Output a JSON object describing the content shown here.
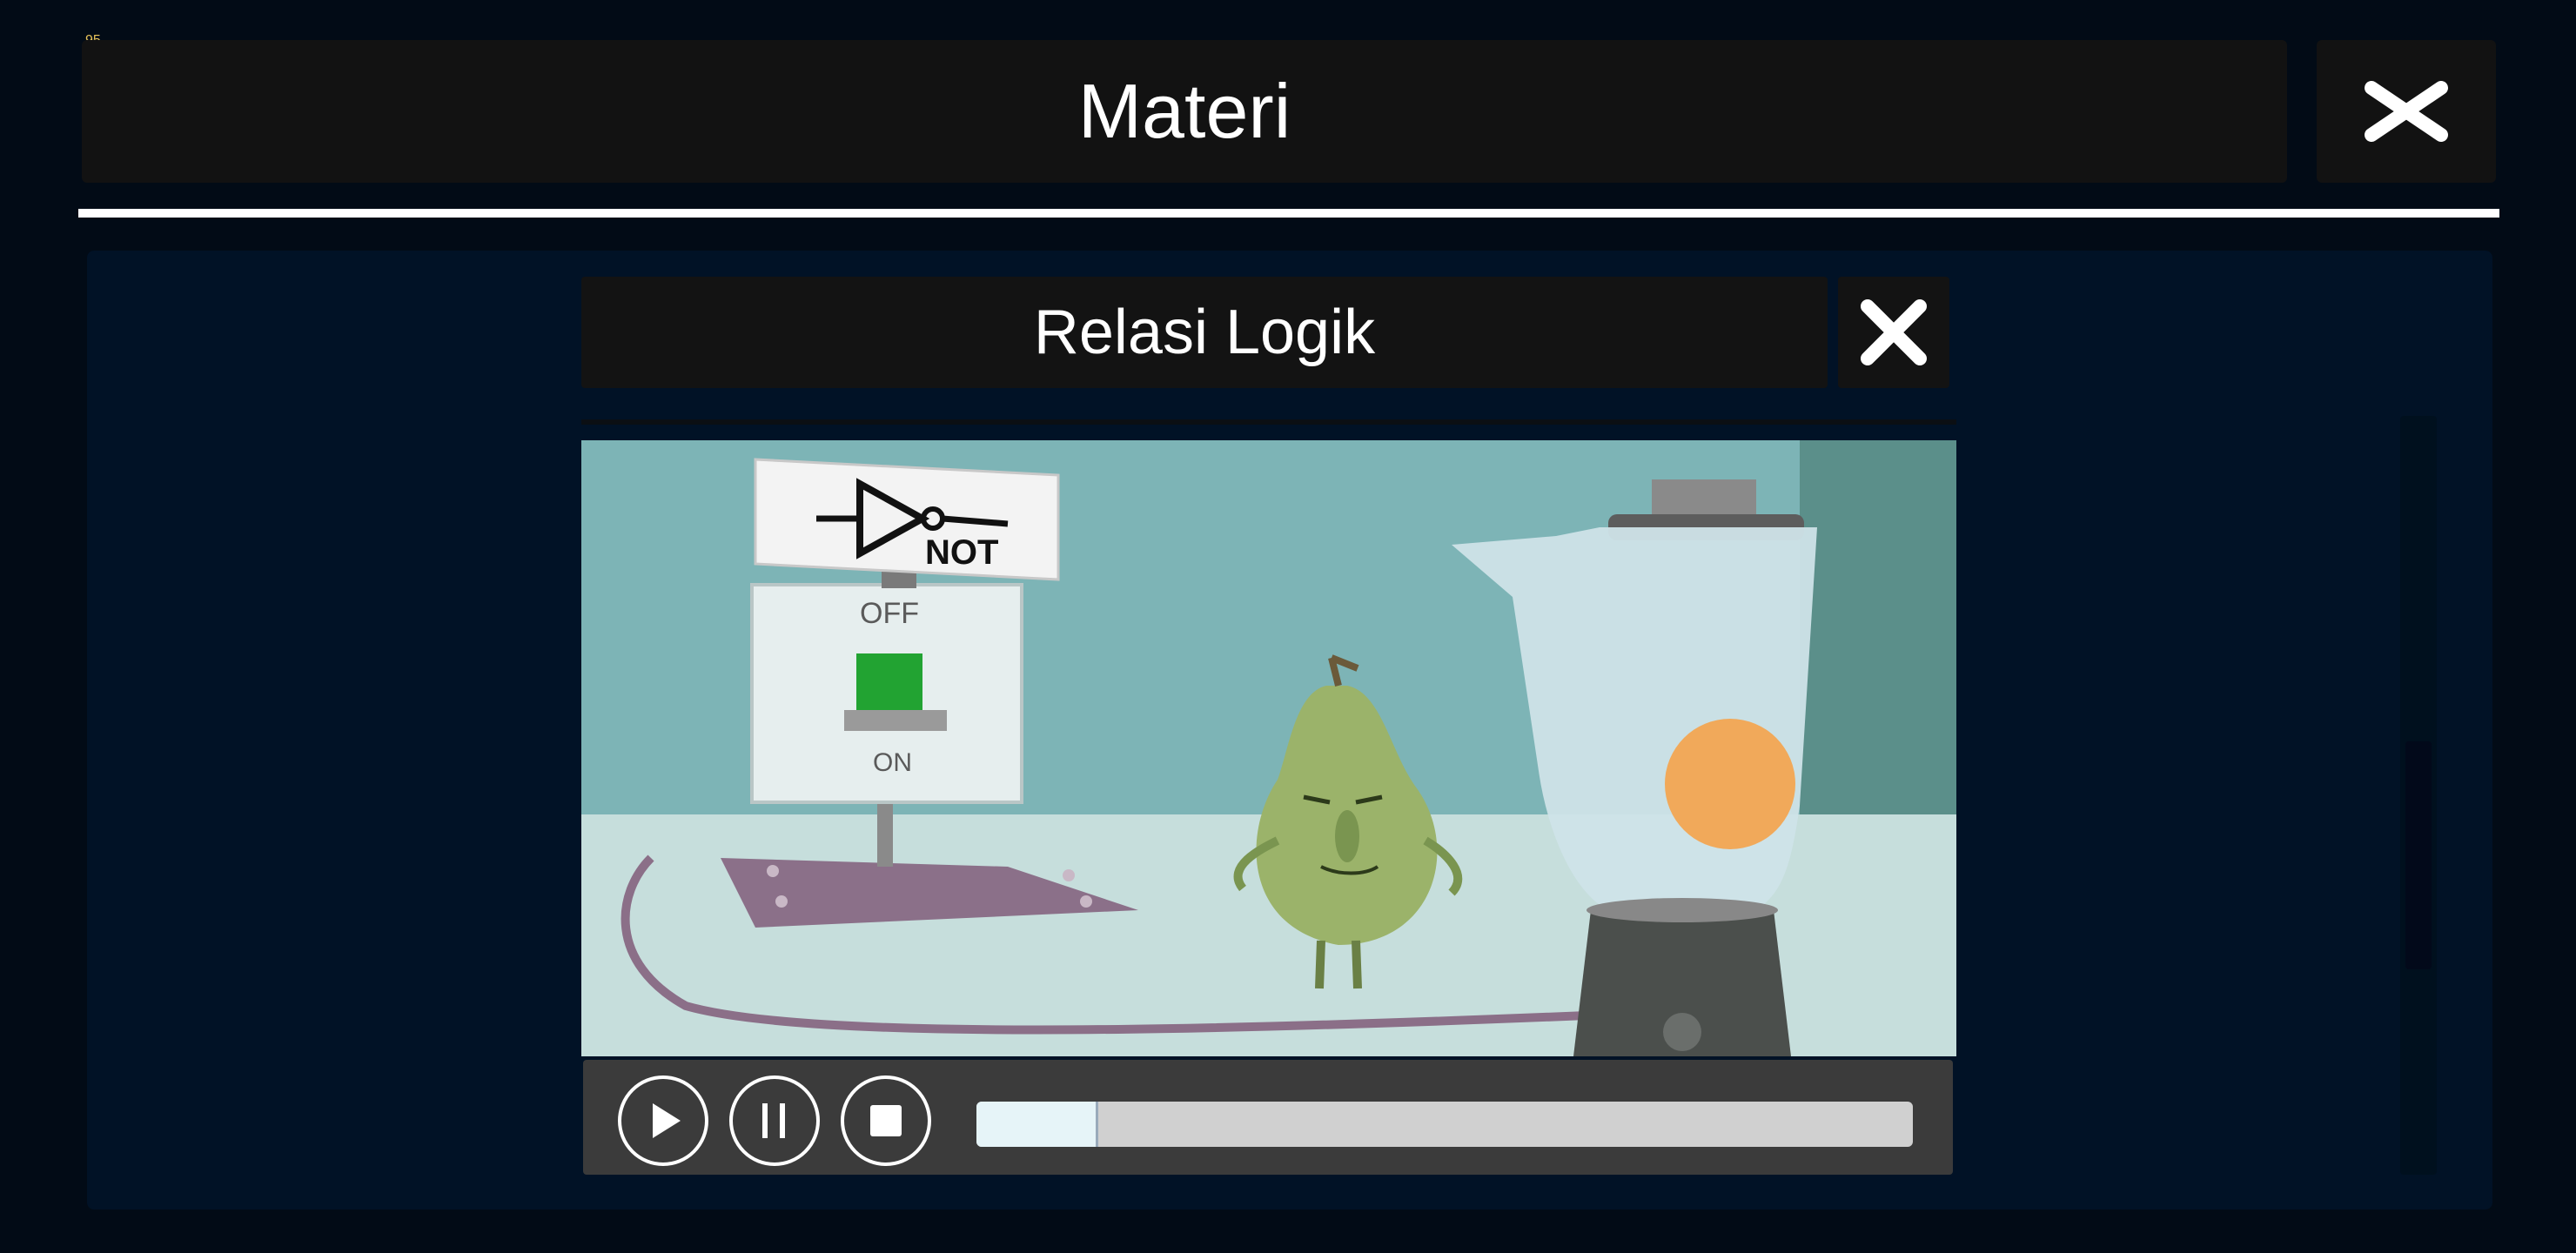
{
  "fps_counter": "95",
  "header": {
    "title": "Materi",
    "close_icon": "close-icon"
  },
  "dialog": {
    "title": "Relasi Logik",
    "close_icon": "close-icon",
    "video": {
      "sign_text": "NOT",
      "switch_off_label": "OFF",
      "switch_on_label": "ON"
    },
    "controls": {
      "play_icon": "play-icon",
      "pause_icon": "pause-icon",
      "stop_icon": "stop-icon",
      "progress": 0.13
    }
  },
  "colors": {
    "background": "#020b16",
    "panel": "#011226",
    "header_bg": "#121212",
    "controls_bg": "#3b3b3b",
    "switch_green": "#22a332"
  }
}
